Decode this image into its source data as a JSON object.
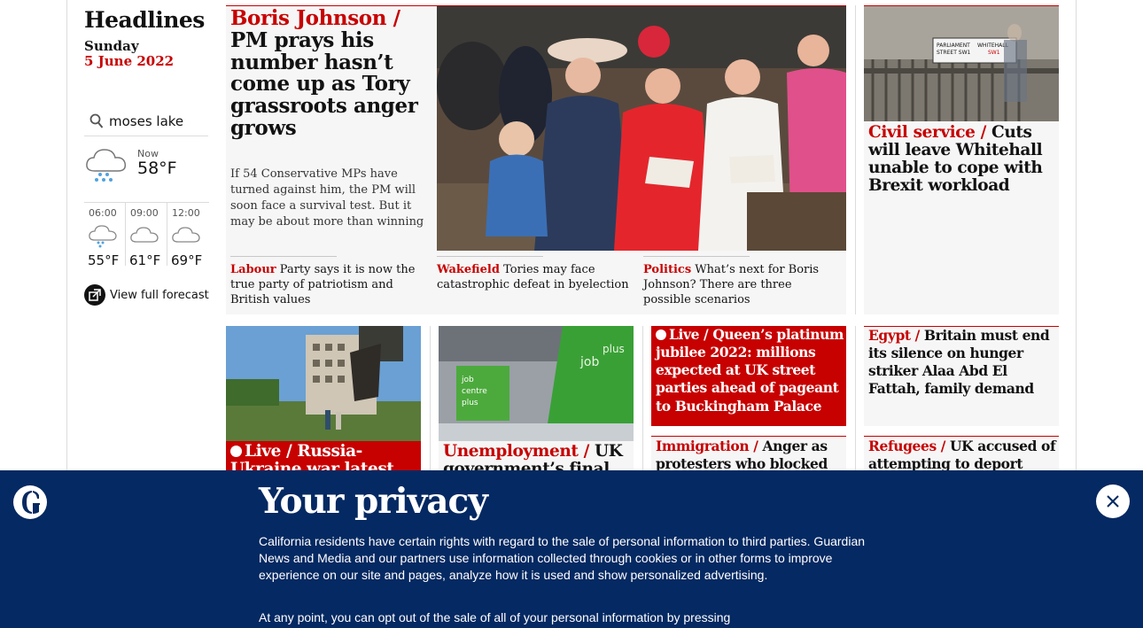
{
  "sidebar": {
    "title": "Headlines",
    "day": "Sunday",
    "date": "5 June 2022",
    "weather": {
      "location": "moses lake",
      "now_label": "Now",
      "now_temp": "58°F",
      "forecast": [
        {
          "time": "06:00",
          "temp": "55°F",
          "icon": "rain-cloud-icon"
        },
        {
          "time": "09:00",
          "temp": "61°F",
          "icon": "cloud-icon"
        },
        {
          "time": "12:00",
          "temp": "69°F",
          "icon": "cloud-icon"
        }
      ],
      "view_forecast": "View full forecast"
    }
  },
  "main_story": {
    "kicker": "Boris Johnson /",
    "headline": "PM prays his number hasn’t come up as Tory grassroots anger grows",
    "standfirst": "If 54 Conservative MPs have turned against him, the PM will soon face a survival test. But it may be about more than winning",
    "sublinks": [
      {
        "kicker": "Labour",
        "text": "Party says it is now the true party of patriotism and British values"
      },
      {
        "kicker": "Wakefield",
        "text": "Tories may face catastrophic defeat in byelection"
      },
      {
        "kicker": "Politics",
        "text": "What’s next for Boris Johnson? There are three possible scenarios"
      }
    ]
  },
  "civil_service": {
    "kicker": "Civil service /",
    "headline": "Cuts will leave Whitehall unable to cope with Brexit workload",
    "sign_line1": "PARLIAMENT",
    "sign_line2": "STREET SW1",
    "sign_line3": "WHITEHALL",
    "sign_line4": "SW1"
  },
  "ukraine": {
    "live": "Live /",
    "headline": "Russia-Ukraine war latest"
  },
  "unemployment": {
    "kicker": "Unemployment /",
    "headline": "UK government’s final",
    "sign_text": "job centre plus"
  },
  "queen": {
    "live": "Live /",
    "headline": "Queen’s platinum jubilee 2022: millions expected at UK street parties ahead of pageant to Buckingham Palace"
  },
  "immigration": {
    "kicker": "Immigration /",
    "headline": "Anger as protesters who blocked UK"
  },
  "egypt": {
    "kicker": "Egypt /",
    "headline": "Britain must end its silence on hunger striker Alaa Abd El Fattah, family demand"
  },
  "refugees": {
    "kicker": "Refugees /",
    "headline": "UK accused of attempting to deport"
  },
  "privacy": {
    "title": "Your privacy",
    "paragraph1": "California residents have certain rights with regard to the sale of personal information to third parties. Guardian News and Media and our partners use information collected through cookies or in other forms to improve experience on our site and pages, analyze how it is used and show personalized advertising.",
    "paragraph2": "At any point, you can opt out of the sale of all of your personal information by pressing"
  },
  "colors": {
    "accent": "#c70000",
    "brand_blue": "#052962"
  }
}
